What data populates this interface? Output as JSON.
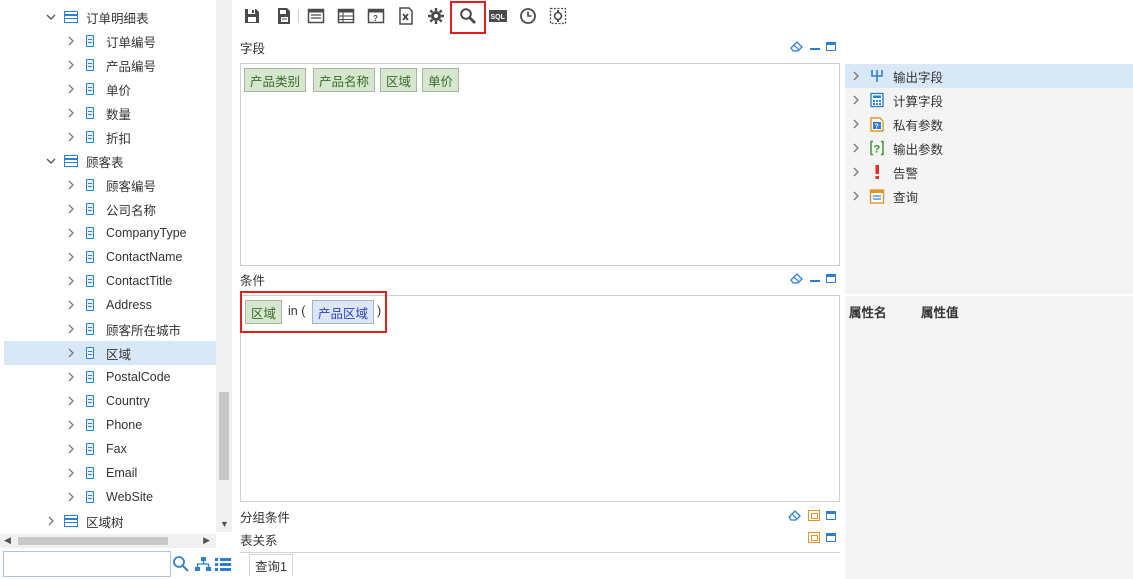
{
  "tree": {
    "nodes": [
      {
        "label": "订单明细表",
        "kind": "table",
        "expanded": true,
        "level": 1
      },
      {
        "label": "订单编号",
        "kind": "field",
        "level": 2
      },
      {
        "label": "产品编号",
        "kind": "field",
        "level": 2
      },
      {
        "label": "单价",
        "kind": "field",
        "level": 2
      },
      {
        "label": "数量",
        "kind": "field",
        "level": 2
      },
      {
        "label": "折扣",
        "kind": "field",
        "level": 2
      },
      {
        "label": "顾客表",
        "kind": "table",
        "expanded": true,
        "level": 1
      },
      {
        "label": "顾客编号",
        "kind": "field",
        "level": 2
      },
      {
        "label": "公司名称",
        "kind": "field",
        "level": 2
      },
      {
        "label": "CompanyType",
        "kind": "field",
        "level": 2
      },
      {
        "label": "ContactName",
        "kind": "field",
        "level": 2
      },
      {
        "label": "ContactTitle",
        "kind": "field",
        "level": 2
      },
      {
        "label": "Address",
        "kind": "field",
        "level": 2
      },
      {
        "label": "顾客所在城市",
        "kind": "field",
        "level": 2
      },
      {
        "label": "区域",
        "kind": "field",
        "level": 2,
        "selected": true
      },
      {
        "label": "PostalCode",
        "kind": "field",
        "level": 2
      },
      {
        "label": "Country",
        "kind": "field",
        "level": 2
      },
      {
        "label": "Phone",
        "kind": "field",
        "level": 2
      },
      {
        "label": "Fax",
        "kind": "field",
        "level": 2
      },
      {
        "label": "Email",
        "kind": "field",
        "level": 2
      },
      {
        "label": "WebSite",
        "kind": "field",
        "level": 2
      },
      {
        "label": "区域树",
        "kind": "table",
        "expanded": false,
        "level": 1
      }
    ]
  },
  "search": {
    "value": "",
    "placeholder": ""
  },
  "toolbar": {
    "buttons": [
      "save-icon",
      "save-as-icon",
      "layout-icon",
      "table-layout-icon",
      "parameter-icon",
      "excel-icon",
      "settings-gear-icon",
      "search-icon",
      "sql-icon",
      "clock-icon",
      "refresh-config-icon"
    ],
    "sql_label": "SQL"
  },
  "panels": {
    "fields": {
      "title": "字段",
      "chips": [
        "产品类别",
        "产品名称",
        "区域",
        "单价"
      ]
    },
    "conditions": {
      "title": "条件",
      "field": "区域",
      "operator": "in (",
      "param": "产品区域",
      "close": ")"
    },
    "group_conditions": {
      "title": "分组条件"
    },
    "table_relations": {
      "title": "表关系"
    }
  },
  "right_tree": [
    {
      "label": "输出字段",
      "icon": "output-field-icon",
      "selected": true
    },
    {
      "label": "计算字段",
      "icon": "calc-field-icon"
    },
    {
      "label": "私有参数",
      "icon": "private-param-icon"
    },
    {
      "label": "输出参数",
      "icon": "output-param-icon"
    },
    {
      "label": "告警",
      "icon": "alarm-icon"
    },
    {
      "label": "查询",
      "icon": "query-icon"
    }
  ],
  "properties": {
    "name_header": "属性名",
    "value_header": "属性值"
  },
  "bottom_tabs": [
    {
      "label": "查询1"
    }
  ],
  "colors": {
    "accent": "#2f7fd0",
    "highlight_red": "#e02020",
    "selection": "#d9e8f7",
    "chip_green": "#d7e6cf",
    "chip_blue": "#dde6f5"
  }
}
